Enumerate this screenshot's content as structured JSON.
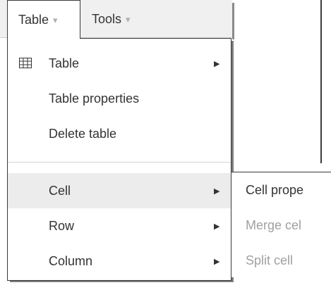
{
  "menubar": {
    "table_label": "Table",
    "tools_label": "Tools",
    "caret": "▾"
  },
  "table_menu": {
    "items": [
      {
        "label": "Table",
        "icon": "table-grid-icon",
        "has_submenu": true
      },
      {
        "label": "Table properties",
        "has_submenu": false
      },
      {
        "label": "Delete table",
        "has_submenu": false
      },
      {
        "label": "Cell",
        "has_submenu": true,
        "highlighted": true
      },
      {
        "label": "Row",
        "has_submenu": true
      },
      {
        "label": "Column",
        "has_submenu": true
      }
    ],
    "submenu_arrow": "▶"
  },
  "cell_submenu": {
    "items": [
      {
        "label": "Cell prope",
        "enabled": true
      },
      {
        "label": "Merge cel",
        "enabled": false
      },
      {
        "label": "Split cell",
        "enabled": false
      }
    ]
  },
  "colors": {
    "highlight": "#ececec",
    "text": "#333333",
    "disabled_text": "#a0a0a0",
    "border": "#3a3a3a"
  }
}
